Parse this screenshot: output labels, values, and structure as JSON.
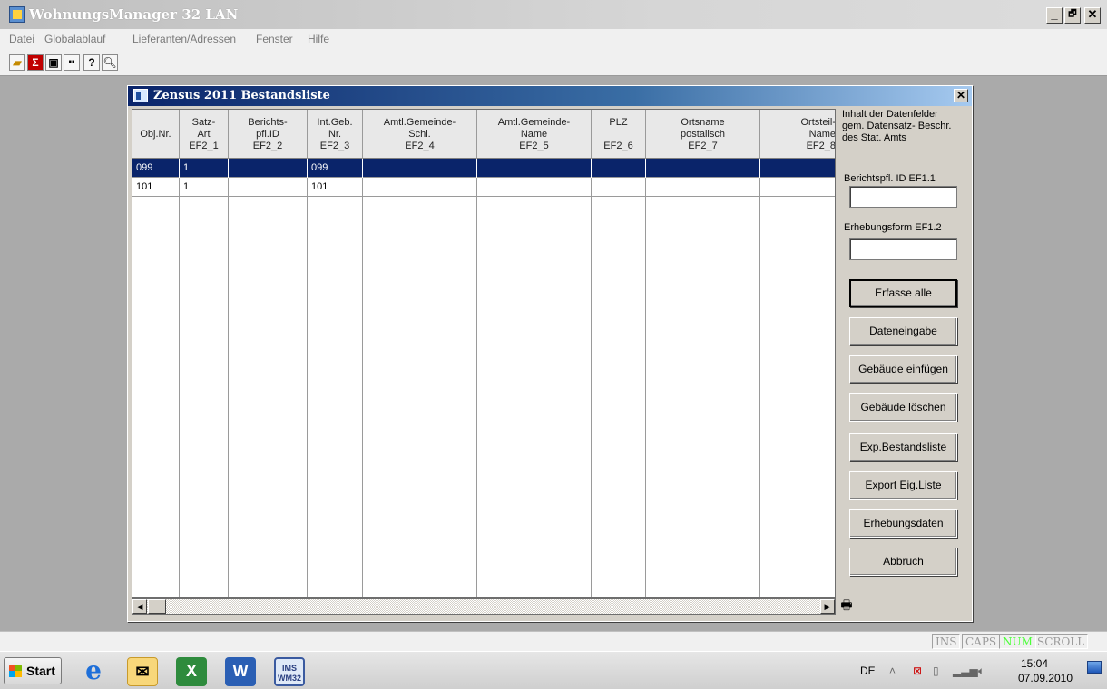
{
  "app": {
    "title": "WohnungsManager 32 LAN",
    "window_buttons": {
      "minimize": "_",
      "maximize": "🗗",
      "close": "✕"
    }
  },
  "menu": [
    "Datei",
    "Globalablauf",
    "Lieferanten/Adressen",
    "Fenster",
    "Hilfe"
  ],
  "toolbar": {
    "icons": [
      "open-folder-icon",
      "sum-icon",
      "save-icon",
      "grid-icon",
      "help-icon",
      "search-icon"
    ],
    "help_label": "?"
  },
  "child": {
    "title": "Zensus 2011 Bestandsliste",
    "close_label": "✕"
  },
  "grid": {
    "columns": [
      {
        "lines": [
          "Obj.Nr."
        ]
      },
      {
        "lines": [
          "Satz-",
          "Art",
          "EF2_1"
        ]
      },
      {
        "lines": [
          "Berichts-",
          "pfl.ID",
          "EF2_2"
        ]
      },
      {
        "lines": [
          "Int.Geb.",
          "Nr.",
          "EF2_3"
        ]
      },
      {
        "lines": [
          "Amtl.Gemeinde-",
          "Schl.",
          "EF2_4"
        ]
      },
      {
        "lines": [
          "Amtl.Gemeinde-",
          "Name",
          "EF2_5"
        ]
      },
      {
        "lines": [
          "PLZ",
          "",
          "EF2_6"
        ]
      },
      {
        "lines": [
          "Ortsname",
          "postalisch",
          "EF2_7"
        ]
      },
      {
        "lines": [
          "Ortsteil-",
          "Name",
          "EF2_8"
        ]
      }
    ],
    "rows": [
      [
        "099",
        "1",
        "",
        "099",
        "",
        "",
        "",
        "",
        ""
      ],
      [
        "101",
        "1",
        "",
        "101",
        "",
        "",
        "",
        "",
        ""
      ]
    ],
    "selected_row": 0
  },
  "panel": {
    "info": [
      "Inhalt der Datenfelder",
      "gem. Datensatz- Beschr.",
      "des Stat. Amts"
    ],
    "field1_label": "Berichtspfl. ID  EF1.1",
    "field1_value": "",
    "field2_label": "Erhebungsform  EF1.2",
    "field2_value": "",
    "buttons": {
      "erfasse_alle": "Erfasse alle",
      "dateneingabe": "Dateneingabe",
      "gebaeude_einfuegen": "Gebäude einfügen",
      "gebaeude_loeschen": "Gebäude löschen",
      "exp_bestandsliste": "Exp.Bestandsliste",
      "export_eig_liste": "Export Eig.Liste",
      "erhebungsdaten": "Erhebungsdaten",
      "abbruch": "Abbruch"
    }
  },
  "statusbar": {
    "indicators": [
      {
        "label": "INS",
        "on": false
      },
      {
        "label": "CAPS",
        "on": false
      },
      {
        "label": "NUM",
        "on": true
      },
      {
        "label": "SCROLL",
        "on": false
      }
    ]
  },
  "taskbar": {
    "start_label": "Start",
    "apps": [
      "internet-explorer-icon",
      "outlook-icon",
      "excel-icon",
      "word-icon",
      "wohnungsmanager-icon"
    ],
    "wm_icon_text": "IMS\nWM32",
    "lang": "DE",
    "time": "15:04",
    "date": "07.09.2010"
  }
}
